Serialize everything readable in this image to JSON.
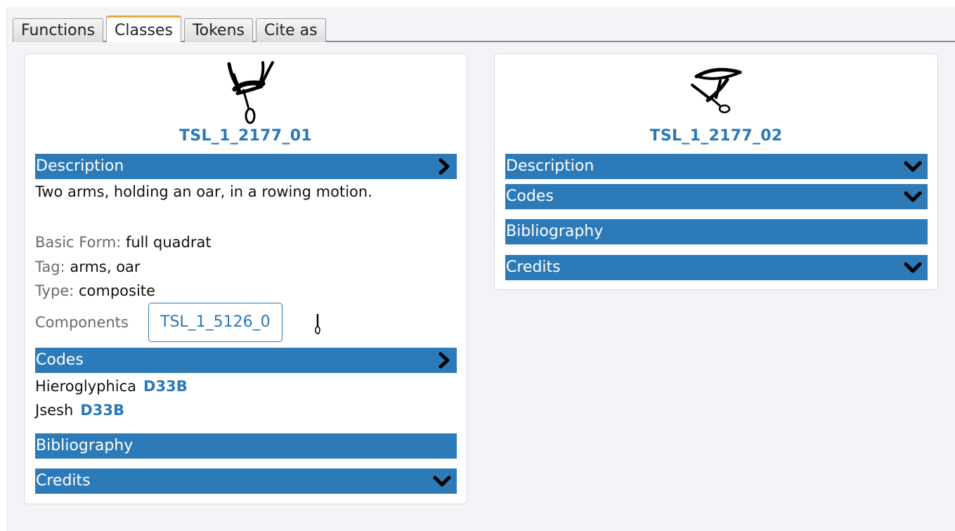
{
  "tabs": [
    {
      "label": "Functions",
      "active": false
    },
    {
      "label": "Classes",
      "active": true
    },
    {
      "label": "Tokens",
      "active": false
    },
    {
      "label": "Cite as",
      "active": false
    }
  ],
  "cards": [
    {
      "sign_id": "TSL_1_2177_01",
      "description_label": "Description",
      "description_text": "Two arms, holding an oar, in a rowing motion.",
      "basic_form_label": "Basic Form:",
      "basic_form_value": "full quadrat",
      "tag_label": "Tag:",
      "tag_value": "arms, oar",
      "type_label": "Type:",
      "type_value": "composite",
      "components_label": "Components",
      "component_id": "TSL_1_5126_0",
      "codes_label": "Codes",
      "codes": [
        {
          "system": "Hieroglyphica",
          "code": "D33B"
        },
        {
          "system": "Jsesh",
          "code": "D33B"
        }
      ],
      "bibliography_label": "Bibliography",
      "credits_label": "Credits"
    },
    {
      "sign_id": "TSL_1_2177_02",
      "description_label": "Description",
      "codes_label": "Codes",
      "bibliography_label": "Bibliography",
      "credits_label": "Credits"
    }
  ],
  "icons": {
    "expanded_chevron": "chevron-right-icon",
    "collapsed_chevron": "chevron-down-icon"
  },
  "colors": {
    "accent": "#2d7ab8",
    "active_tab_border": "#f0a53b"
  }
}
